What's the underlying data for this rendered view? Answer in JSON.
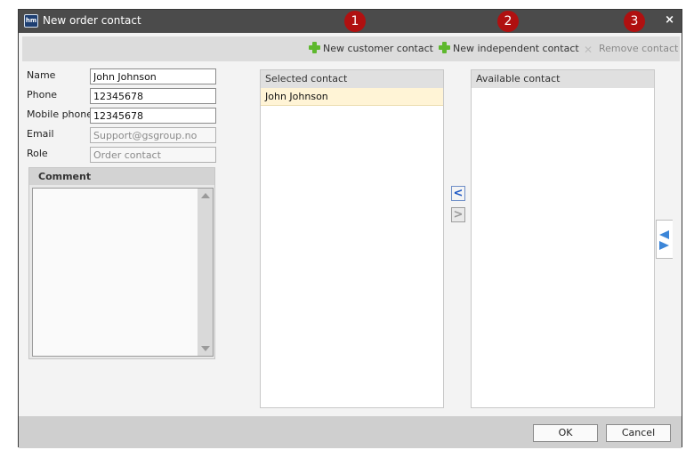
{
  "window": {
    "app_icon_text": "hm",
    "title": "New order contact",
    "close_glyph": "×"
  },
  "badges": [
    "1",
    "2",
    "3"
  ],
  "toolbar": {
    "new_customer_contact": "New customer contact",
    "new_independent_contact": "New independent contact",
    "remove_contact": "Remove contact"
  },
  "form": {
    "name": {
      "label": "Name",
      "value": "John Johnson"
    },
    "phone": {
      "label": "Phone",
      "value": "12345678"
    },
    "mobile_phone": {
      "label": "Mobile phone",
      "value": "12345678"
    },
    "email": {
      "label": "Email",
      "value": "Support@gsgroup.no"
    },
    "role": {
      "label": "Role",
      "value": "Order contact"
    }
  },
  "comment": {
    "header": "Comment",
    "value": ""
  },
  "selected_contact": {
    "header": "Selected contact",
    "items": [
      "John Johnson"
    ]
  },
  "available_contact": {
    "header": "Available contact",
    "items": []
  },
  "arrows": {
    "move_left": "<",
    "move_right": ">"
  },
  "footer": {
    "ok_label": "OK",
    "cancel_label": "Cancel"
  },
  "icons": [
    "app-icon",
    "close-icon",
    "plus-icon",
    "remove-icon",
    "chevron-left-icon",
    "chevron-right-icon",
    "swap-arrows-icon",
    "scroll-up-icon",
    "scroll-down-icon"
  ],
  "colors": {
    "titlebar": "#4b4b4b",
    "badge": "#b01010",
    "plus": "#5eb82e",
    "selected_row": "#fff4d6",
    "arrow_blue": "#1a55c4"
  }
}
